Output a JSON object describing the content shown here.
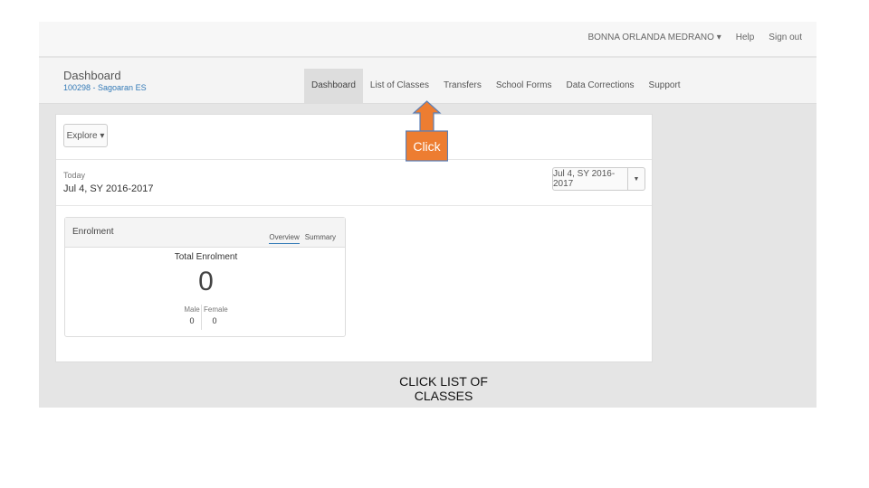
{
  "user_menu": {
    "name": "BONNA ORLANDA MEDRANO ▾",
    "help": "Help",
    "signout": "Sign out"
  },
  "brand": {
    "title": "Dashboard",
    "subtitle": "100298 - Sagoaran ES"
  },
  "nav": {
    "tabs": [
      "Dashboard",
      "List of Classes",
      "Transfers",
      "School Forms",
      "Data Corrections",
      "Support"
    ]
  },
  "toolbar": {
    "explore_label": "Explore ▾"
  },
  "today": {
    "label": "Today",
    "value": "Jul 4, SY 2016-2017"
  },
  "date_selector": {
    "value": "Jul 4, SY 2016-2017",
    "caret": "▼"
  },
  "enrolment": {
    "title": "Enrolment",
    "tabs": [
      "Overview",
      "Summary"
    ],
    "total_label": "Total Enrolment",
    "total_value": "0",
    "male_label": "Male",
    "male_value": "0",
    "female_label": "Female",
    "female_value": "0"
  },
  "callout": {
    "label": "Click",
    "color": "#ed7d31"
  },
  "caption": "CLICK LIST OF CLASSES"
}
